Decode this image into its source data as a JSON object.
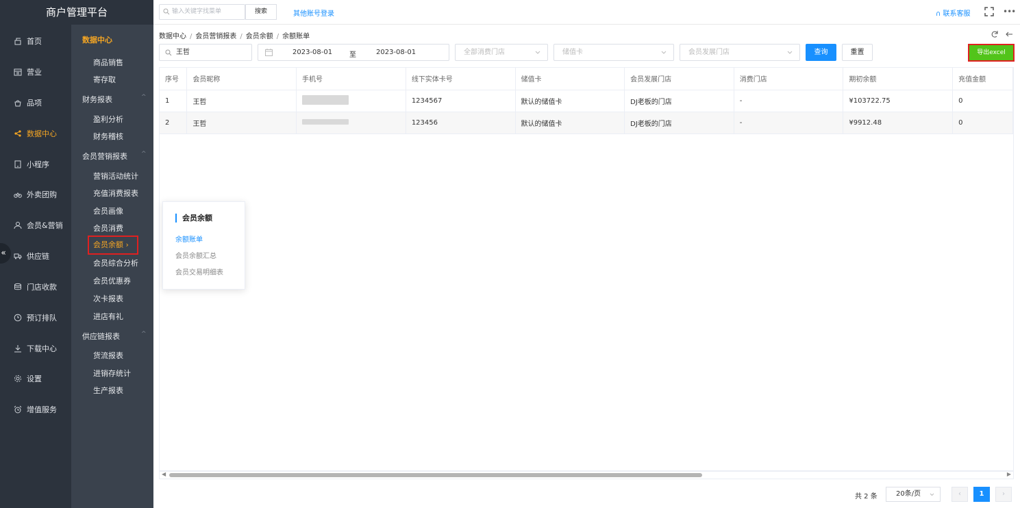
{
  "app": {
    "title": "商户管理平台"
  },
  "topbar": {
    "search_placeholder": "输入关键字找菜单",
    "search_button": "搜索",
    "other_login": "其他账号登录",
    "contact": "联系客服",
    "more": "•••"
  },
  "nav": [
    {
      "label": "首页",
      "icon": "home-icon"
    },
    {
      "label": "营业",
      "icon": "calendar-icon"
    },
    {
      "label": "品项",
      "icon": "bag-icon"
    },
    {
      "label": "数据中心",
      "icon": "share-icon",
      "active": true
    },
    {
      "label": "小程序",
      "icon": "tablet-icon"
    },
    {
      "label": "外卖团购",
      "icon": "bike-icon"
    },
    {
      "label": "会员&营销",
      "icon": "user-icon"
    },
    {
      "label": "供应链",
      "icon": "truck-icon"
    },
    {
      "label": "门店收款",
      "icon": "wallet-icon"
    },
    {
      "label": "预订排队",
      "icon": "clock-icon"
    },
    {
      "label": "下载中心",
      "icon": "download-icon"
    },
    {
      "label": "设置",
      "icon": "gear-icon"
    },
    {
      "label": "增值服务",
      "icon": "alarm-icon"
    }
  ],
  "subnav": {
    "header": "数据中心",
    "groups": [
      {
        "label": "商品销售"
      },
      {
        "label": "寄存取"
      },
      {
        "label": "财务报表"
      },
      {
        "label": "盈利分析"
      },
      {
        "label": "财务稽核"
      },
      {
        "label": "会员营销报表"
      },
      {
        "label": "营销活动统计"
      },
      {
        "label": "充值消费报表"
      },
      {
        "label": "会员画像"
      },
      {
        "label": "会员消费"
      },
      {
        "label": "会员余额"
      },
      {
        "label": "会员综合分析"
      },
      {
        "label": "会员优惠券"
      },
      {
        "label": "次卡报表"
      },
      {
        "label": "进店有礼"
      },
      {
        "label": "供应链报表"
      },
      {
        "label": "货流报表"
      },
      {
        "label": "进销存统计"
      },
      {
        "label": "生产报表"
      }
    ],
    "active_arrow": "›",
    "caret": "^"
  },
  "breadcrumb": [
    "数据中心",
    "会员营销报表",
    "会员余额",
    "余额账单"
  ],
  "filters": {
    "name_value": "王哲",
    "date_start": "2023-08-01",
    "date_sep": "至",
    "date_end": "2023-08-01",
    "store_placeholder": "全部消费门店",
    "card_placeholder": "储值卡",
    "dev_store_placeholder": "会员发展门店",
    "query": "查询",
    "reset": "重置",
    "export": "导出excel"
  },
  "table": {
    "columns": [
      "序号",
      "会员昵称",
      "手机号",
      "线下实体卡号",
      "储值卡",
      "会员发展门店",
      "消费门店",
      "期初余额",
      "充值金额"
    ],
    "rows": [
      [
        "1",
        "王哲",
        "",
        "1234567",
        "默认的储值卡",
        "DJ老板的门店",
        "-",
        "¥103722.75",
        "0"
      ],
      [
        "2",
        "王哲",
        "",
        "123456",
        "默认的储值卡",
        "DJ老板的门店",
        "-",
        "¥9912.48",
        "0"
      ]
    ]
  },
  "pagination": {
    "total": "共 2 条",
    "page_size": "20条/页",
    "current": "1",
    "prev": "‹",
    "next": "›"
  },
  "popover": {
    "title": "会员余额",
    "items": [
      "余额账单",
      "会员余额汇总",
      "会员交易明细表"
    ]
  },
  "collapse_glyph": "«"
}
